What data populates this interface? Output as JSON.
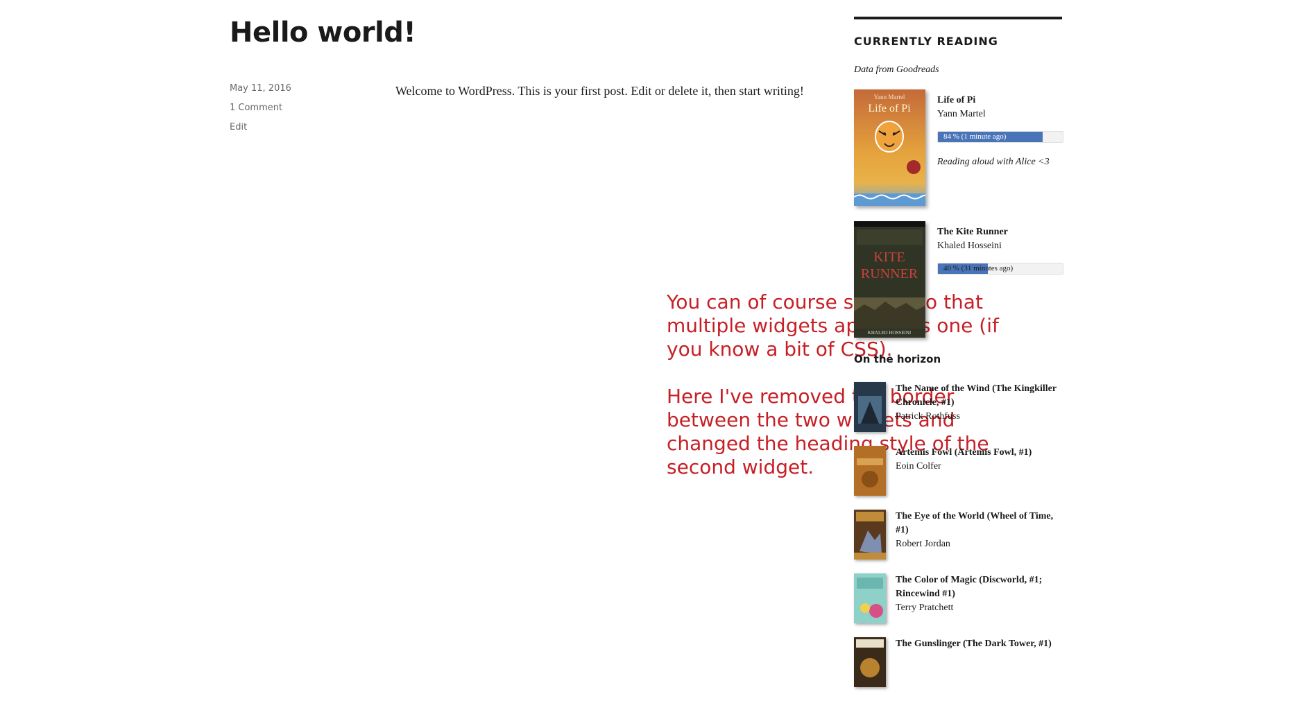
{
  "post": {
    "title": "Hello world!",
    "date": "May 11, 2016",
    "comments": "1 Comment",
    "edit": "Edit",
    "body": "Welcome to WordPress. This is your first post. Edit or delete it, then start writing!"
  },
  "annotation": {
    "p1": "You can of course style it so that multiple widgets appear as one (if you know a bit of CSS).",
    "p2": "Here I've removed the border between the two widgets and changed the heading style of the second widget."
  },
  "colors": {
    "accent": "#c62026",
    "progress": "#4a74b8",
    "text": "#1a1a1a"
  },
  "currently_reading": {
    "heading": "CURRENTLY READING",
    "note": "Data from Goodreads",
    "books": [
      {
        "title": "Life of Pi",
        "author": "Yann Martel",
        "progress_text": "84 % (1 minute ago)",
        "progress_percent": 84,
        "comment": "Reading aloud with Alice <3",
        "cover_icon": "book-cover-life-of-pi",
        "cover_text": [
          "Yann Martel",
          "Life of Pi"
        ]
      },
      {
        "title": "The Kite Runner",
        "author": "Khaled Hosseini",
        "progress_text": "40 % (31 minutes ago)",
        "progress_percent": 40,
        "cover_icon": "book-cover-kite-runner",
        "cover_text": [
          "KITE",
          "RUNNER",
          "KHALED HOSSEINI"
        ]
      }
    ]
  },
  "on_the_horizon": {
    "heading": "On the horizon",
    "books": [
      {
        "title": "The Name of the Wind (The Kingkiller Chronicle, #1)",
        "author": "Patrick Rothfuss",
        "cover_icon": "book-cover-name-of-the-wind"
      },
      {
        "title": "Artemis Fowl (Artemis Fowl, #1)",
        "author": "Eoin Colfer",
        "cover_icon": "book-cover-artemis-fowl"
      },
      {
        "title": "The Eye of the World (Wheel of Time, #1)",
        "author": "Robert Jordan",
        "cover_icon": "book-cover-eye-of-the-world"
      },
      {
        "title": "The Color of Magic (Discworld, #1; Rincewind #1)",
        "author": "Terry Pratchett",
        "cover_icon": "book-cover-color-of-magic"
      },
      {
        "title": "The Gunslinger (The Dark Tower, #1)",
        "author": "",
        "cover_icon": "book-cover-gunslinger"
      }
    ]
  }
}
